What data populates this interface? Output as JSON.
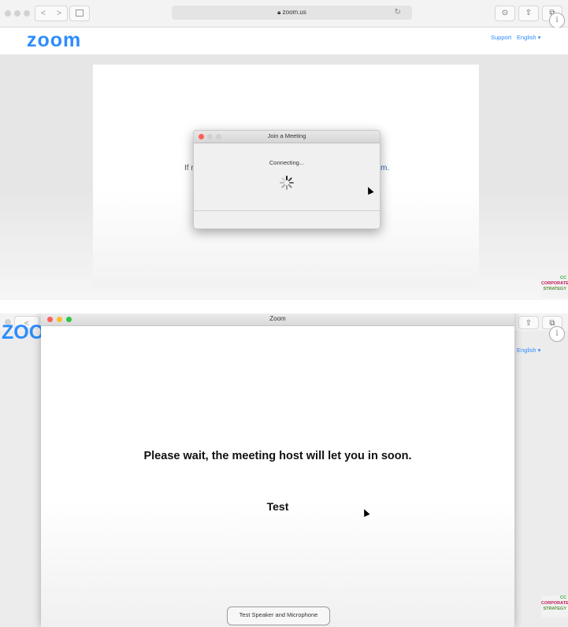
{
  "browser": {
    "url": "zoom.us",
    "nav_back": "<",
    "nav_forward": ">",
    "info_glyph": "i"
  },
  "zoom_site": {
    "logo": "zoom",
    "support_link": "Support",
    "language": "English ▾",
    "bg_text_left": "If r",
    "bg_text_right": "m."
  },
  "join_dialog": {
    "title": "Join a Meeting",
    "status": "Connecting..."
  },
  "watermark": {
    "line1": "CC",
    "line2": "CORPORATE",
    "line3": "STRATEGY"
  },
  "zoom_window": {
    "title": "Zoom",
    "waiting_message": "Please wait, the meeting host will let you in soon.",
    "meeting_name": "Test",
    "test_button": "Test Speaker and Microphone"
  },
  "bottom_peek": {
    "logo_partial": "ZOO",
    "language": "English ▾"
  },
  "colors": {
    "zoom_blue": "#2d8cff",
    "close_red": "#ff5f57",
    "minimize_yellow": "#febc2e",
    "zoom_green": "#28c840"
  }
}
